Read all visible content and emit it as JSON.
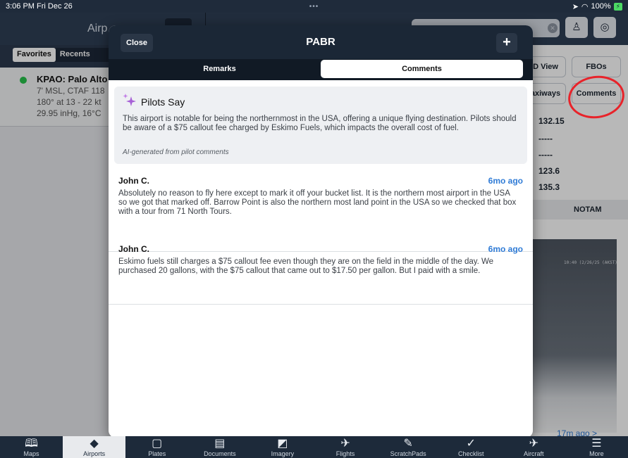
{
  "status_bar": {
    "time": "3:06 PM  Fri Dec 26",
    "dots": "•••",
    "battery": "100%"
  },
  "left_panel": {
    "title": "Airp",
    "segments": [
      "Favorites",
      "Recents"
    ],
    "airport": {
      "name": "KPAO: Palo Alto",
      "lines": [
        "7' MSL, CTAF 118",
        "180° at 13 - 22 kt",
        "29.95 inHg, 16°C"
      ]
    }
  },
  "right_panel": {
    "buttons": [
      "D View",
      "FBOs",
      "axiways",
      "Comments"
    ],
    "frequencies": [
      "132.15",
      "-----",
      "-----",
      "123.6",
      "135.3"
    ],
    "notam_tab": "NOTAM",
    "webcam_timestamp": "10:40 (2/26/25 (AKST)",
    "updated_link": "17m ago  >"
  },
  "modal": {
    "close_label": "Close",
    "title": "PABR",
    "add_label": "+",
    "tabs": [
      "Remarks",
      "Comments"
    ],
    "active_tab": "Comments",
    "summary": {
      "title": "Pilots Say",
      "text": "This airport is notable for being the northernmost in the USA, offering a unique flying destination. Pilots should be aware of a $75 callout fee charged by Eskimo Fuels, which impacts the overall cost of fuel.",
      "note": "AI-generated from pilot comments"
    },
    "comments": [
      {
        "author": "John C.",
        "time": "6mo ago",
        "text": "Absolutely no reason to fly here except to mark it off your bucket list. It is the northern most airport in the USA so we got that marked off. Barrow Point is also the northern most land point in the USA so we checked that box with a tour from 71 North Tours."
      },
      {
        "author": "John C.",
        "time": "6mo ago",
        "text": "Eskimo fuels still charges a $75 callout fee even though they are on the field in the middle of the day. We purchased 20 gallons, with the $75 callout that came out to $17.50 per gallon. But I paid with a smile."
      }
    ]
  },
  "tab_bar": {
    "active": "Airports",
    "items": [
      {
        "label": "Maps",
        "icon": "map-icon"
      },
      {
        "label": "Airports",
        "icon": "airport-icon"
      },
      {
        "label": "Plates",
        "icon": "plates-icon"
      },
      {
        "label": "Documents",
        "icon": "documents-icon"
      },
      {
        "label": "Imagery",
        "icon": "imagery-icon"
      },
      {
        "label": "Flights",
        "icon": "flights-icon"
      },
      {
        "label": "ScratchPads",
        "icon": "pencil-icon"
      },
      {
        "label": "Checklist",
        "icon": "checkmark-icon"
      },
      {
        "label": "Aircraft",
        "icon": "aircraft-icon"
      },
      {
        "label": "More",
        "icon": "menu-icon"
      }
    ]
  },
  "colors": {
    "accent": "#2f7bd6",
    "header": "#1b2736",
    "annotation": "#e8232a",
    "favorite_dot": "#27c24c"
  }
}
